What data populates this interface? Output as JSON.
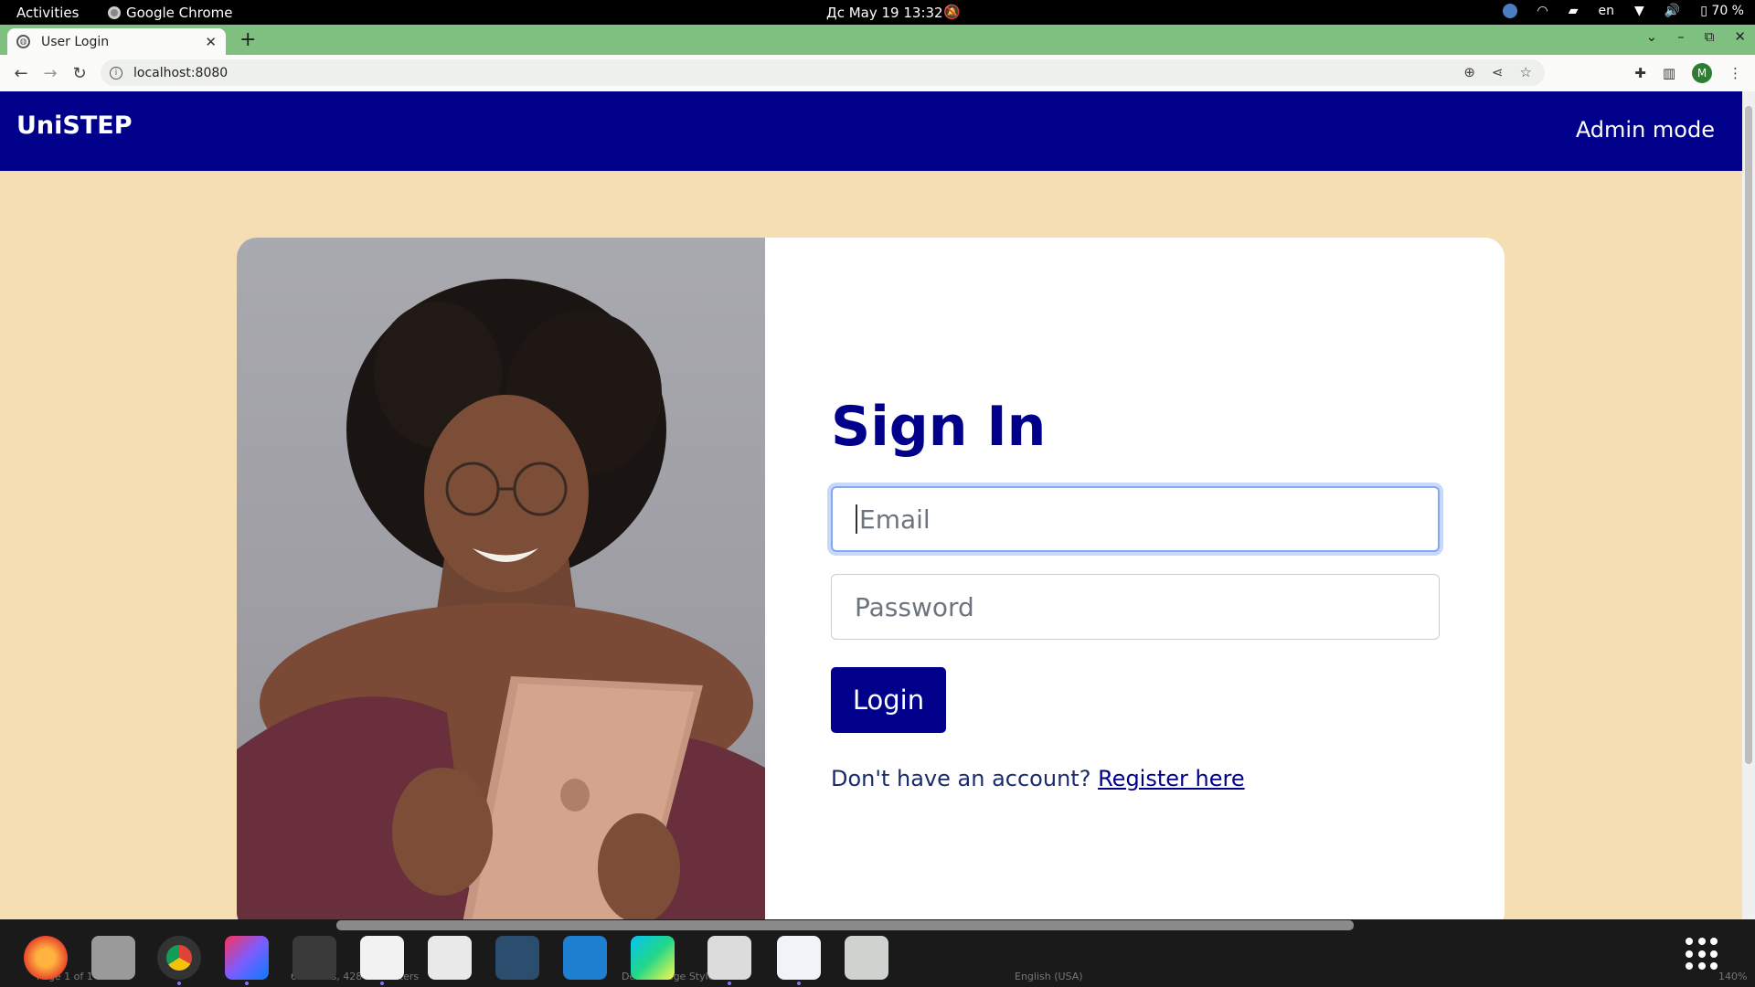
{
  "system_bar": {
    "activities": "Activities",
    "app_name": "Google Chrome",
    "clock": "Дс May 19  13:32",
    "lang": "en",
    "battery": "70 %"
  },
  "browser": {
    "tab_title": "User Login",
    "url": "localhost:8080"
  },
  "page": {
    "brand": "UniSTEP",
    "admin_link": "Admin mode",
    "form": {
      "title": "Sign In",
      "email_placeholder": "Email",
      "password_placeholder": "Password",
      "login_label": "Login",
      "register_prompt": "Don't have an account?",
      "register_link": "Register here"
    }
  },
  "dock": {
    "apps": [
      "firefox-icon",
      "files-icon",
      "chrome-icon",
      "intellij-icon",
      "terminal-icon",
      "text-editor-icon",
      "document-viewer-icon",
      "mysql-workbench-icon",
      "vscode-icon",
      "webstorm-icon",
      "java-duke-icon",
      "libreoffice-writer-icon",
      "trash-icon"
    ],
    "background_text": {
      "page": "Page 1 of 1",
      "words": "65 words, 428 characters",
      "style": "Default Page Style",
      "language": "English (USA)",
      "zoom": "140%"
    }
  },
  "colors": {
    "primary": "#00008b",
    "page_bg": "#f5deb3",
    "tabstrip": "#7fbf7f"
  }
}
